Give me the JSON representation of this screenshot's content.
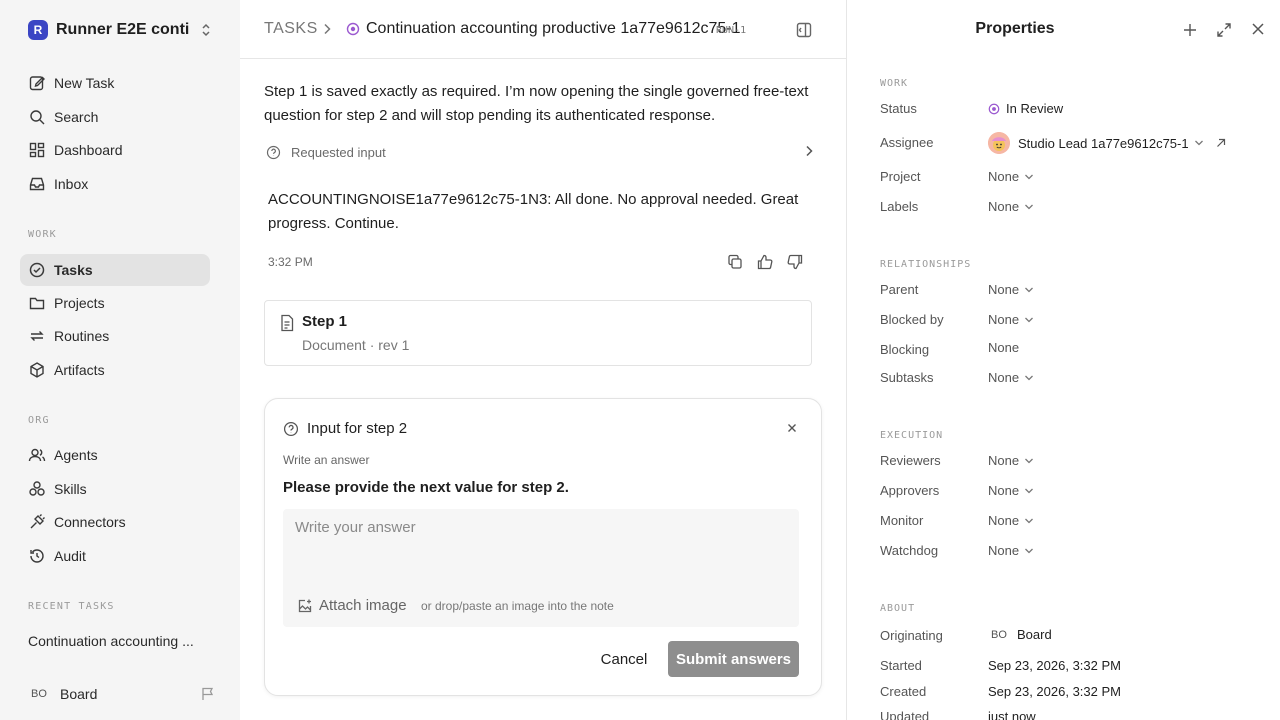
{
  "sidebar": {
    "workspace_logo": "R",
    "workspace_name": "Runner E2E conti...",
    "nav": [
      {
        "label": "New Task",
        "icon": "edit-icon"
      },
      {
        "label": "Search",
        "icon": "search-icon"
      },
      {
        "label": "Dashboard",
        "icon": "dashboard-icon"
      },
      {
        "label": "Inbox",
        "icon": "inbox-icon"
      }
    ],
    "work_label": "WORK",
    "work": [
      {
        "label": "Tasks",
        "icon": "check-circle-icon",
        "active": true
      },
      {
        "label": "Projects",
        "icon": "folder-icon"
      },
      {
        "label": "Routines",
        "icon": "repeat-icon"
      },
      {
        "label": "Artifacts",
        "icon": "box-icon"
      }
    ],
    "org_label": "ORG",
    "org": [
      {
        "label": "Agents",
        "icon": "users-icon"
      },
      {
        "label": "Skills",
        "icon": "skills-icon"
      },
      {
        "label": "Connectors",
        "icon": "plug-icon"
      },
      {
        "label": "Audit",
        "icon": "history-icon"
      }
    ],
    "recent_label": "RECENT TASKS",
    "recent_item": "Continuation accounting ...",
    "user_initials": "BO",
    "user_name": "Board"
  },
  "header": {
    "root": "TASKS",
    "title": "Continuation accounting productive 1a77e9612c75-1",
    "run_tag": "RUN-1"
  },
  "thread": {
    "message": "Step 1 is saved exactly as required. I’m now opening the single governed free-text question for step 2 and will stop pending its authenticated response.",
    "requested_input_label": "Requested input",
    "answer": "ACCOUNTINGNOISE1a77e9612c75-1N3: All done. No approval needed. Great progress. Continue.",
    "time": "3:32 PM"
  },
  "document": {
    "title": "Step 1",
    "subtitle": "Document · rev 1"
  },
  "form": {
    "title": "Input for step 2",
    "label": "Write an answer",
    "prompt": "Please provide the next value for step 2.",
    "placeholder": "Write your answer",
    "attach_label": "Attach image",
    "attach_hint": "or drop/paste an image into the note",
    "cancel_label": "Cancel",
    "submit_label": "Submit answers"
  },
  "properties": {
    "title": "Properties",
    "work_label": "WORK",
    "status_label": "Status",
    "status_value": "In Review",
    "assignee_label": "Assignee",
    "assignee_value": "Studio Lead 1a77e9612c75-1",
    "project_label": "Project",
    "project_value": "None",
    "labels_label": "Labels",
    "labels_value": "None",
    "relationships_label": "RELATIONSHIPS",
    "parent_label": "Parent",
    "parent_value": "None",
    "blocked_by_label": "Blocked by",
    "blocked_by_value": "None",
    "blocking_label": "Blocking",
    "blocking_value": "None",
    "subtasks_label": "Subtasks",
    "subtasks_value": "None",
    "execution_label": "EXECUTION",
    "reviewers_label": "Reviewers",
    "reviewers_value": "None",
    "approvers_label": "Approvers",
    "approvers_value": "None",
    "monitor_label": "Monitor",
    "monitor_value": "None",
    "watchdog_label": "Watchdog",
    "watchdog_value": "None",
    "about_label": "ABOUT",
    "originating_label": "Originating",
    "originating_initials": "BO",
    "originating_value": "Board",
    "started_label": "Started",
    "started_value": "Sep 23, 2026, 3:32 PM",
    "created_label": "Created",
    "created_value": "Sep 23, 2026, 3:32 PM",
    "updated_label": "Updated",
    "updated_value": "just now"
  },
  "colors": {
    "status_in_review": "#9b59d0",
    "workspace_logo_bg": "#3b45c4",
    "submit_bg": "#8e8e8e"
  }
}
